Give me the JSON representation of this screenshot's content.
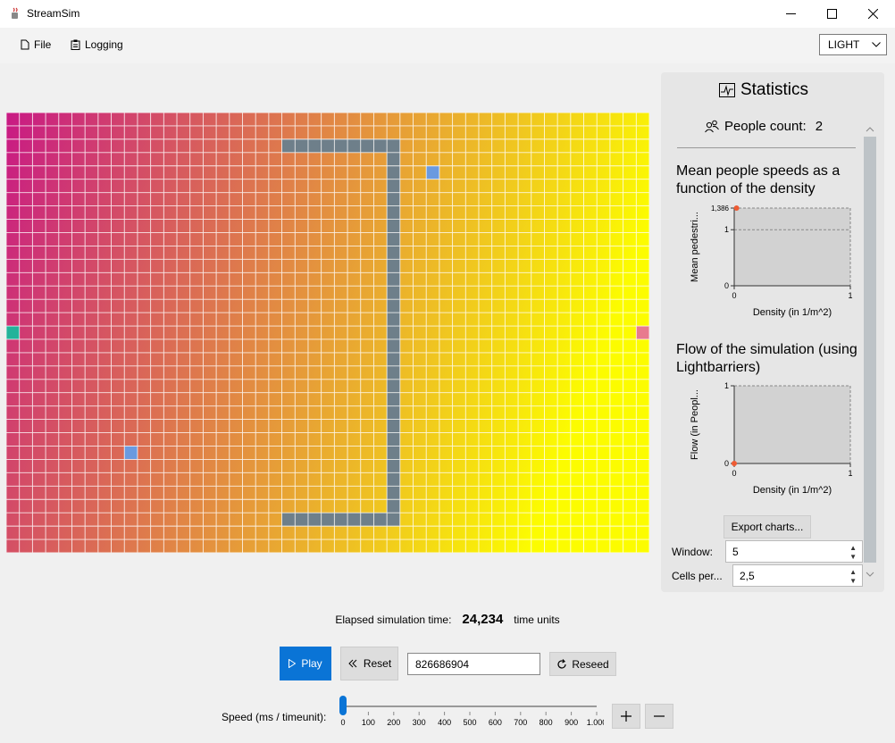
{
  "window": {
    "title": "StreamSim"
  },
  "menu": {
    "file": "File",
    "logging": "Logging",
    "theme": "LIGHT"
  },
  "stats": {
    "title": "Statistics",
    "people_label": "People count:",
    "people_count": "2",
    "chart1_title": "Mean people speeds as a function of the density",
    "chart2_title": "Flow of the simulation (using Lightbarriers)",
    "export_label": "Export charts...",
    "window_label": "Window:",
    "window_value": "5",
    "cells_label": "Cells per...",
    "cells_value": "2,5"
  },
  "chart_data": [
    {
      "type": "scatter",
      "ylabel": "Mean pedestri...",
      "xlabel": "Density (in 1/m^2)",
      "yticks": [
        "0",
        "1",
        "1,386"
      ],
      "xticks": [
        "0",
        "1"
      ],
      "xlim": [
        0,
        1
      ],
      "ylim": [
        0,
        1.386
      ],
      "points": [
        {
          "x": 0.02,
          "y": 1.386
        }
      ],
      "colors": {
        "point": "#ee5b33",
        "plot_bg": "#d2d2d2"
      }
    },
    {
      "type": "scatter",
      "ylabel": "Flow (in Peopl...",
      "xlabel": "Density (in 1/m^2)",
      "yticks": [
        "0",
        "1"
      ],
      "xticks": [
        "0",
        "1"
      ],
      "xlim": [
        0,
        1
      ],
      "ylim": [
        0,
        1
      ],
      "points": [
        {
          "x": 0.0,
          "y": 0.0
        }
      ],
      "colors": {
        "point": "#ee5b33",
        "plot_bg": "#d2d2d2"
      }
    }
  ],
  "simulation": {
    "elapsed_label": "Elapsed simulation time:",
    "elapsed_value": "24,234",
    "elapsed_unit": "time units",
    "play_label": "Play",
    "reset_label": "Reset",
    "seed_value": "826686904",
    "reseed_label": "Reseed",
    "speed_label": "Speed (ms / timeunit):",
    "speed_ticks": [
      "0",
      "100",
      "200",
      "300",
      "400",
      "500",
      "600",
      "700",
      "800",
      "900",
      "1.000"
    ],
    "speed_value": 0,
    "speed_max": 1000
  },
  "grid": {
    "cols": 49,
    "rows": 33,
    "gradient": [
      "#c81a84",
      "#fcfc00"
    ],
    "wall_color": "#6e7f8a",
    "person_color": "#6a9ae0",
    "source_color": "#23b39a",
    "target_color": "#e87a8e"
  }
}
